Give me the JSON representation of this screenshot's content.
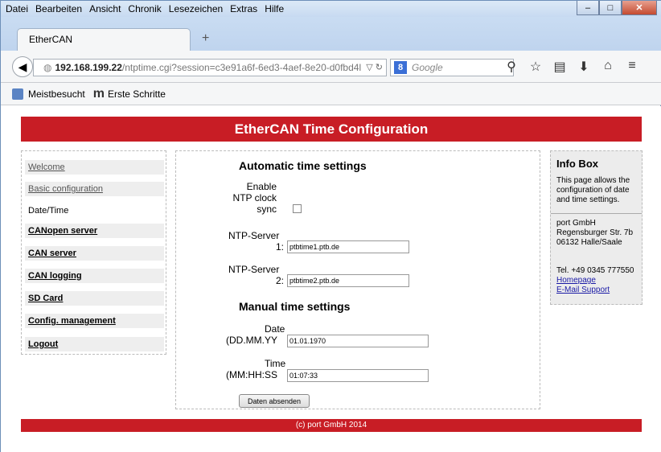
{
  "menu": [
    "Datei",
    "Bearbeiten",
    "Ansicht",
    "Chronik",
    "Lesezeichen",
    "Extras",
    "Hilfe"
  ],
  "tab": {
    "title": "EtherCAN",
    "new_tab": "+"
  },
  "url": {
    "host": "192.168.199.22",
    "rest": "/ntptime.cgi?session=c3e91a6f-6ed3-4aef-8e20-d0fbd4l"
  },
  "search": {
    "placeholder": "Google"
  },
  "bookmarks": {
    "most_visited": "Meistbesucht",
    "first_steps": "Erste Schritte"
  },
  "page": {
    "title": "EtherCAN Time Configuration",
    "footer": "(c) port GmbH 2014"
  },
  "sidebar": [
    {
      "label": "Welcome"
    },
    {
      "label": "Basic configuration"
    },
    {
      "label": "Date/Time"
    },
    {
      "label": "CANopen server"
    },
    {
      "label": "CAN server"
    },
    {
      "label": "CAN logging"
    },
    {
      "label": "SD Card"
    },
    {
      "label": "Config. management"
    },
    {
      "label": "Logout"
    }
  ],
  "auto": {
    "heading": "Automatic time settings",
    "enable_label_1": "Enable",
    "enable_label_2": "NTP clock",
    "enable_label_3": "sync",
    "ntp1_label": "NTP-Server",
    "ntp1_num": "1:",
    "ntp1_value": "ptbtime1.ptb.de",
    "ntp2_label": "NTP-Server",
    "ntp2_num": "2:",
    "ntp2_value": "ptbtime2.ptb.de"
  },
  "manual": {
    "heading": "Manual time settings",
    "date_label_1": "Date",
    "date_label_2": "(DD.MM.YY",
    "date_value": "01.01.1970",
    "time_label_1": "Time",
    "time_label_2": "(MM:HH:SS",
    "time_value": "01:07:33",
    "submit": "Daten absenden"
  },
  "info": {
    "heading": "Info Box",
    "text_1": "This page allows the",
    "text_2": "configuration of date",
    "text_3": "and time settings.",
    "company": "port GmbH",
    "street": "Regensburger Str. 7b",
    "city": "06132 Halle/Saale",
    "phone": "Tel. +49 0345 777550",
    "homepage": "Homepage",
    "email": "E-Mail Support"
  }
}
